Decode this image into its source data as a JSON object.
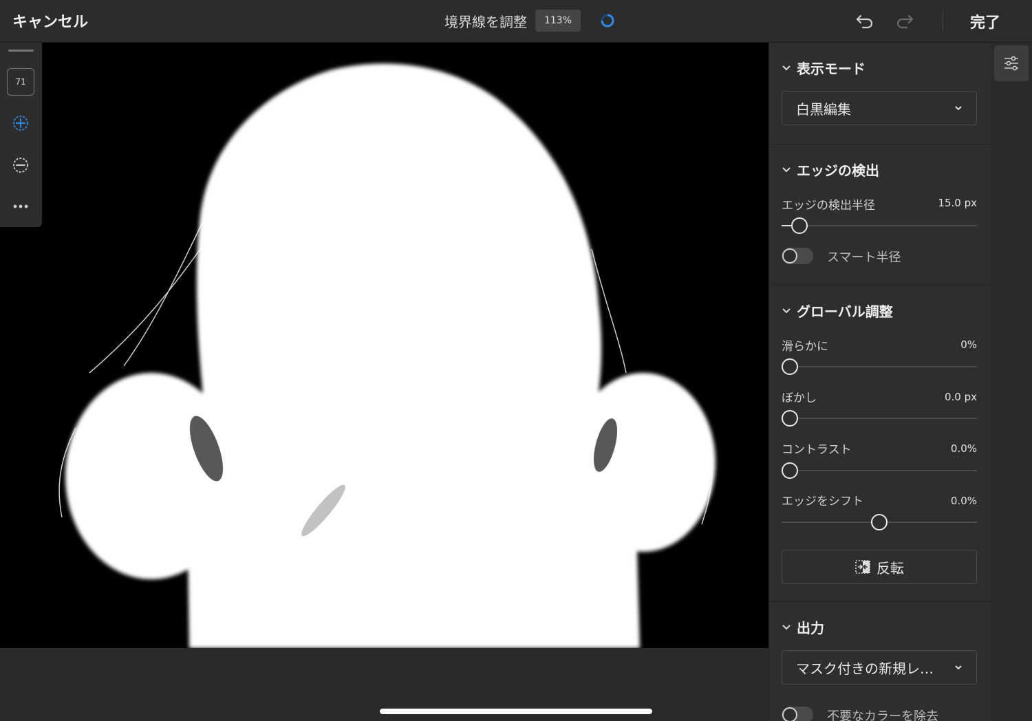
{
  "header": {
    "cancel_label": "キャンセル",
    "title": "境界線を調整",
    "zoom": "113%",
    "done_label": "完了"
  },
  "toolbar": {
    "brush_size": "71"
  },
  "panel": {
    "display_mode": {
      "heading": "表示モード",
      "selected": "白黒編集"
    },
    "edge_detection": {
      "heading": "エッジの検出",
      "radius_label": "エッジの検出半径",
      "radius_value": "15.0 px",
      "radius_fraction": 0.03,
      "smart_radius_label": "スマート半径",
      "smart_radius_on": false
    },
    "global": {
      "heading": "グローバル調整",
      "smooth_label": "滑らかに",
      "smooth_value": "0%",
      "blur_label": "ぼかし",
      "blur_value": "0.0 px",
      "contrast_label": "コントラスト",
      "contrast_value": "0.0%",
      "shift_label": "エッジをシフト",
      "shift_value": "0.0%",
      "invert_label": "反転"
    },
    "output": {
      "heading": "出力",
      "selected": "マスク付きの新規レ…",
      "decontaminate_label": "不要なカラーを除去",
      "decontaminate_on": false
    }
  },
  "colors": {
    "accent": "#2d8ceb",
    "background": "#2b2b2b",
    "canvas": "#000000"
  }
}
